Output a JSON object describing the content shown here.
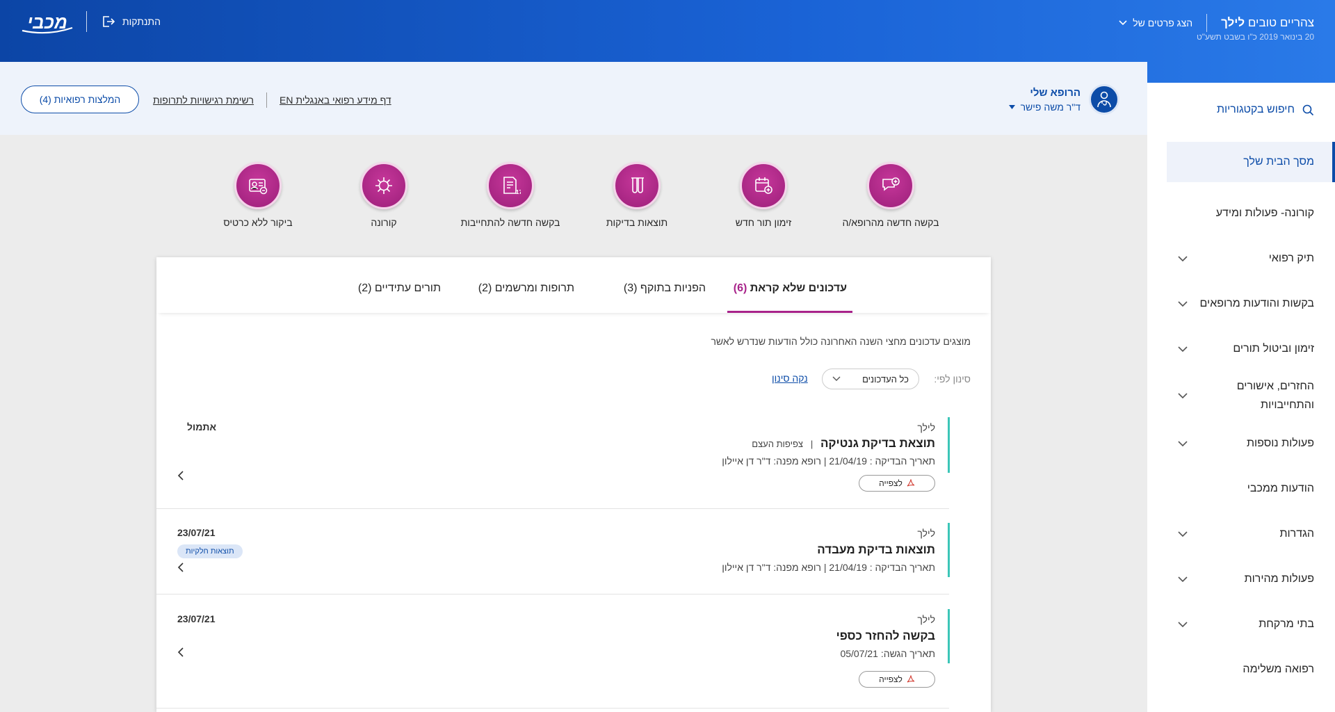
{
  "header": {
    "greeting_prefix": "צהריים טובים",
    "greeting_name": "לילך",
    "member_select": "הצג פרטים של",
    "date": "20 בינואר 2019 כ\"ו בשבט תשע\"ט",
    "logout": "התנתקות",
    "brand": "מכבי"
  },
  "sidebar": {
    "search": "חיפוש בקטגוריות",
    "items": [
      {
        "label": "מסך הבית שלך",
        "active": true
      },
      {
        "label": "קורונה- פעולות ומידע"
      },
      {
        "label": "תיק רפואי"
      },
      {
        "label": "בקשות והודעות מרופאים"
      },
      {
        "label": "זימון וביטול תורים"
      },
      {
        "label": "החזרים, אישורים והתחייבויות"
      },
      {
        "label": "פעולות נוספות"
      },
      {
        "label": "הודעות ממכבי"
      },
      {
        "label": "הגדרות"
      },
      {
        "label": "פעולות מהירות"
      },
      {
        "label": "בתי מרקחת"
      },
      {
        "label": "רפואה משלימה"
      }
    ]
  },
  "doctor": {
    "title": "הרופא שלי",
    "name": "ד\"ר משה פישר"
  },
  "links": {
    "english_info": "דף מידע רפואי באנגלית EN",
    "sensitivities": "רשימת רגישויות לתרופות"
  },
  "recommendations_button": "המלצות רפואיות (4)",
  "actions": [
    {
      "label": "בקשה חדשה מהרופא/ה",
      "icon": "chat-plus-icon"
    },
    {
      "label": "זימון תור חדש",
      "icon": "calendar-plus-icon"
    },
    {
      "label": "תוצאות בדיקות",
      "icon": "test-tubes-icon"
    },
    {
      "label": "בקשה חדשה להתחייבות",
      "icon": "document-17-icon"
    },
    {
      "label": "קורונה",
      "icon": "virus-icon"
    },
    {
      "label": "ביקור ללא כרטיס",
      "icon": "id-card-icon"
    }
  ],
  "tabs": [
    {
      "label": "עדכונים שלא קראת",
      "count": "(6)",
      "active": true
    },
    {
      "label": "הפניות בתוקף",
      "count": "(3)"
    },
    {
      "label": "תרופות ומרשמים",
      "count": "(2)"
    },
    {
      "label": "תורים עתידיים",
      "count": "(2)"
    }
  ],
  "feed": {
    "subtitle": "מוצגים עדכונים מחצי השנה האחרונה כולל הודעות שנדרש לאשר",
    "filter_label": "סינון לפי:",
    "filter_value": "כל העדכונים",
    "clear_filter": "נקה סינון",
    "view_label": "לצפייה",
    "items": [
      {
        "who": "לילך",
        "title": "תוצאת בדיקת גנטיקה",
        "subtitle": "צפיפות העצם",
        "meta": "תאריך הבדיקה : 21/04/19 | רופא מפנה: ד\"ר דן איילון",
        "side": "אתמול"
      },
      {
        "who": "לילך",
        "title": "תוצאות בדיקת מעבדה",
        "meta": "תאריך הבדיקה : 21/04/19 |  רופא מפנה: ד\"ר דן איילון",
        "date": "23/07/21",
        "badge": "תוצאות חלקיות"
      },
      {
        "who": "לילך",
        "title": "בקשה להחזר כספי",
        "meta": "תאריך הגשה: 05/07/21",
        "date": "23/07/21"
      }
    ]
  }
}
